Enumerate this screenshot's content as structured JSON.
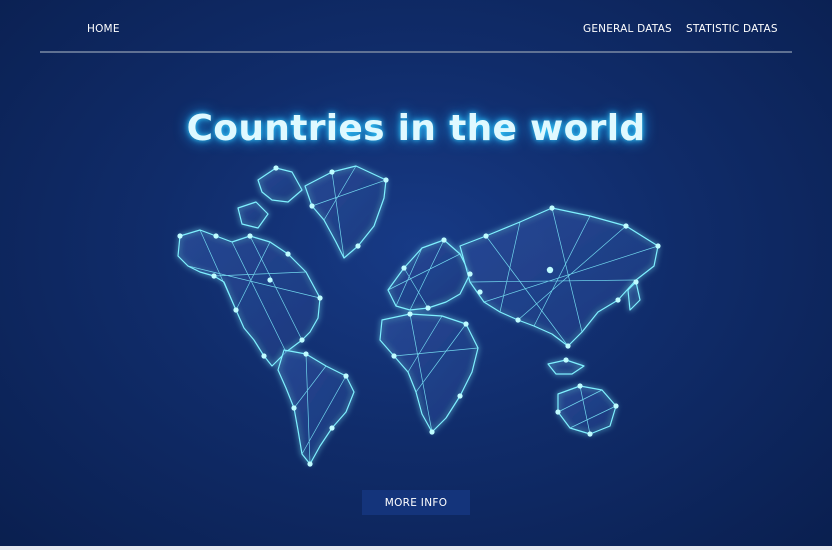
{
  "nav": {
    "home": "HOME",
    "general": "GENERAL DATAS",
    "statistic": "STATISTIC DATAS"
  },
  "hero": {
    "title": "Countries in the world"
  },
  "cta": {
    "label": "MORE  INFO"
  },
  "colors": {
    "background": "#102c6a",
    "accent_glow": "#36d3ff",
    "button": "#14347b"
  },
  "icons": {
    "map": "world-map-network-icon"
  }
}
